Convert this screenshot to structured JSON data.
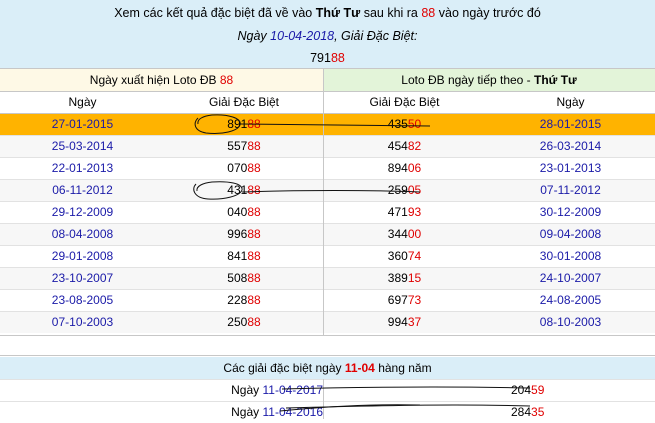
{
  "header": {
    "line1_prefix": "Xem các kết quả đặc biệt đã về vào ",
    "line1_day": "Thứ Tư",
    "line1_middle": " sau khi ra ",
    "line1_num": "88",
    "line1_suffix": " vào ngày trước đó",
    "line2_prefix": "Ngày ",
    "line2_date": "10-04-2018",
    "line2_suffix": ", Giải Đặc Biệt:",
    "prize_prefix": "791",
    "prize_suffix": "88"
  },
  "table": {
    "left_group_prefix": "Ngày xuất hiện Loto ĐB ",
    "left_group_num": "88",
    "right_group_prefix": "Loto ĐB ngày tiếp theo - ",
    "right_group_day": "Thứ Tư",
    "col_date": "Ngày",
    "col_prize": "Giải Đặc Biệt",
    "col_prize2": "Giải Đặc Biệt",
    "col_date2": "Ngày",
    "rows": [
      {
        "d1": "27-01-2015",
        "p1a": "891",
        "p1b": "88",
        "p2a": "435",
        "p2b": "50",
        "d2": "28-01-2015"
      },
      {
        "d1": "25-03-2014",
        "p1a": "557",
        "p1b": "88",
        "p2a": "454",
        "p2b": "82",
        "d2": "26-03-2014"
      },
      {
        "d1": "22-01-2013",
        "p1a": "070",
        "p1b": "88",
        "p2a": "894",
        "p2b": "06",
        "d2": "23-01-2013"
      },
      {
        "d1": "06-11-2012",
        "p1a": "431",
        "p1b": "88",
        "p2a": "259",
        "p2b": "05",
        "d2": "07-11-2012"
      },
      {
        "d1": "29-12-2009",
        "p1a": "040",
        "p1b": "88",
        "p2a": "471",
        "p2b": "93",
        "d2": "30-12-2009"
      },
      {
        "d1": "08-04-2008",
        "p1a": "996",
        "p1b": "88",
        "p2a": "344",
        "p2b": "00",
        "d2": "09-04-2008"
      },
      {
        "d1": "29-01-2008",
        "p1a": "841",
        "p1b": "88",
        "p2a": "360",
        "p2b": "74",
        "d2": "30-01-2008"
      },
      {
        "d1": "23-10-2007",
        "p1a": "508",
        "p1b": "88",
        "p2a": "389",
        "p2b": "15",
        "d2": "24-10-2007"
      },
      {
        "d1": "23-08-2005",
        "p1a": "228",
        "p1b": "88",
        "p2a": "697",
        "p2b": "73",
        "d2": "24-08-2005"
      },
      {
        "d1": "07-10-2003",
        "p1a": "250",
        "p1b": "88",
        "p2a": "994",
        "p2b": "37",
        "d2": "08-10-2003"
      }
    ]
  },
  "annual": {
    "title_prefix": "Các giải đặc biệt ngày ",
    "title_date": "11-04",
    "title_suffix": " hàng năm",
    "rows": [
      {
        "label": "Ngày ",
        "date": "11-04-2017",
        "pa": "204",
        "pb": "59"
      },
      {
        "label": "Ngày ",
        "date": "11-04-2016",
        "pa": "284",
        "pb": "35"
      }
    ]
  },
  "colors": {
    "header_bg": "#daeef8",
    "left_group_bg": "#fef9e6",
    "right_group_bg": "#e3f4d9",
    "highlight_row": "#ffb300",
    "accent_red": "#e00000",
    "date_blue": "#1a1aa8"
  }
}
